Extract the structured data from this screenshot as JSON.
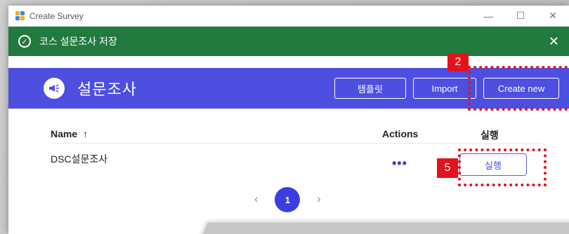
{
  "window": {
    "title": "Create Survey",
    "controls": [
      "—",
      "☐",
      "✕"
    ]
  },
  "toast": {
    "message": "코스 설문조사 저장",
    "close": "✕"
  },
  "header": {
    "title": "설문조사",
    "buttons": {
      "template": "템플릿",
      "import": "Import",
      "create_new": "Create new"
    }
  },
  "table": {
    "columns": {
      "name": "Name",
      "sort_arrow": "↑",
      "actions": "Actions",
      "run": "실행"
    },
    "rows": [
      {
        "name": "DSC설문조사",
        "actions": "•••",
        "run": "실행"
      }
    ]
  },
  "pagination": {
    "prev": "‹",
    "current_page": "1",
    "next": "›"
  },
  "annotations": {
    "step_2": "2",
    "step_5": "5",
    "color": "#e3121b"
  },
  "colors": {
    "toast_green": "#237a3f",
    "header_purple": "#4d4fe0",
    "accent_blue": "#3b3de0"
  }
}
